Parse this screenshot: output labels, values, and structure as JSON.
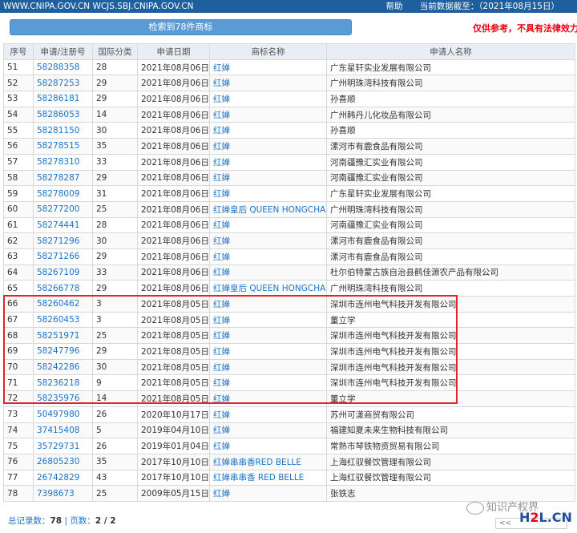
{
  "topbar": {
    "urls": "WWW.CNIPA.GOV.CN WCJS.SBJ.CNIPA.GOV.CN",
    "help": "帮助",
    "data_date": "当前数据截至：（2021年08月15日）"
  },
  "result_count": "检索到78件商标",
  "disclaimer": "仅供参考，不具有法律效力",
  "columns": [
    "序号",
    "申请/注册号",
    "国际分类",
    "申请日期",
    "商标名称",
    "申请人名称"
  ],
  "rows": [
    {
      "no": "51",
      "reg": "58288358",
      "cls": "28",
      "date": "2021年08月06日",
      "mark": "红婵",
      "applicant": "广东星轩实业发展有限公司"
    },
    {
      "no": "52",
      "reg": "58287253",
      "cls": "29",
      "date": "2021年08月06日",
      "mark": "红婵",
      "applicant": "广州明珠湾科技有限公司"
    },
    {
      "no": "53",
      "reg": "58286181",
      "cls": "29",
      "date": "2021年08月06日",
      "mark": "红婵",
      "applicant": "孙喜顺"
    },
    {
      "no": "54",
      "reg": "58286053",
      "cls": "14",
      "date": "2021年08月06日",
      "mark": "红婵",
      "applicant": "广州韩丹儿化妆品有限公司"
    },
    {
      "no": "55",
      "reg": "58281150",
      "cls": "30",
      "date": "2021年08月06日",
      "mark": "红婵",
      "applicant": "孙喜顺"
    },
    {
      "no": "56",
      "reg": "58278515",
      "cls": "35",
      "date": "2021年08月06日",
      "mark": "红婵",
      "applicant": "漯河市有鹿食品有限公司"
    },
    {
      "no": "57",
      "reg": "58278310",
      "cls": "33",
      "date": "2021年08月06日",
      "mark": "红婵",
      "applicant": "河南疆豫汇实业有限公司"
    },
    {
      "no": "58",
      "reg": "58278287",
      "cls": "29",
      "date": "2021年08月06日",
      "mark": "红婵",
      "applicant": "河南疆豫汇实业有限公司"
    },
    {
      "no": "59",
      "reg": "58278009",
      "cls": "31",
      "date": "2021年08月06日",
      "mark": "红婵",
      "applicant": "广东星轩实业发展有限公司"
    },
    {
      "no": "60",
      "reg": "58277200",
      "cls": "25",
      "date": "2021年08月06日",
      "mark": "红婵皇后 QUEEN HONGCHAN",
      "applicant": "广州明珠湾科技有限公司"
    },
    {
      "no": "61",
      "reg": "58274441",
      "cls": "28",
      "date": "2021年08月06日",
      "mark": "红婵",
      "applicant": "河南疆豫汇实业有限公司"
    },
    {
      "no": "62",
      "reg": "58271296",
      "cls": "30",
      "date": "2021年08月06日",
      "mark": "红婵",
      "applicant": "漯河市有鹿食品有限公司"
    },
    {
      "no": "63",
      "reg": "58271266",
      "cls": "29",
      "date": "2021年08月06日",
      "mark": "红婵",
      "applicant": "漯河市有鹿食品有限公司"
    },
    {
      "no": "64",
      "reg": "58267109",
      "cls": "33",
      "date": "2021年08月06日",
      "mark": "红婵",
      "applicant": "杜尔伯特蒙古族自治县鹤佳源农产品有限公司"
    },
    {
      "no": "65",
      "reg": "58266778",
      "cls": "29",
      "date": "2021年08月06日",
      "mark": "红婵皇后 QUEEN HONGCHAN",
      "applicant": "广州明珠湾科技有限公司"
    },
    {
      "no": "66",
      "reg": "58260462",
      "cls": "3",
      "date": "2021年08月05日",
      "mark": "红婵",
      "applicant": "深圳市连州电气科技开发有限公司"
    },
    {
      "no": "67",
      "reg": "58260453",
      "cls": "3",
      "date": "2021年08月05日",
      "mark": "红婵",
      "applicant": "董立学"
    },
    {
      "no": "68",
      "reg": "58251971",
      "cls": "25",
      "date": "2021年08月05日",
      "mark": "红婵",
      "applicant": "深圳市连州电气科技开发有限公司"
    },
    {
      "no": "69",
      "reg": "58247796",
      "cls": "29",
      "date": "2021年08月05日",
      "mark": "红婵",
      "applicant": "深圳市连州电气科技开发有限公司"
    },
    {
      "no": "70",
      "reg": "58242286",
      "cls": "30",
      "date": "2021年08月05日",
      "mark": "红婵",
      "applicant": "深圳市连州电气科技开发有限公司"
    },
    {
      "no": "71",
      "reg": "58236218",
      "cls": "9",
      "date": "2021年08月05日",
      "mark": "红婵",
      "applicant": "深圳市连州电气科技开发有限公司"
    },
    {
      "no": "72",
      "reg": "58235976",
      "cls": "14",
      "date": "2021年08月05日",
      "mark": "红婵",
      "applicant": "董立学"
    },
    {
      "no": "73",
      "reg": "50497980",
      "cls": "26",
      "date": "2020年10月17日",
      "mark": "红婵",
      "applicant": "苏州可漾商贸有限公司"
    },
    {
      "no": "74",
      "reg": "37415408",
      "cls": "5",
      "date": "2019年04月10日",
      "mark": "红婵",
      "applicant": "福建知夏未来生物科技有限公司"
    },
    {
      "no": "75",
      "reg": "35729731",
      "cls": "26",
      "date": "2019年01月04日",
      "mark": "红婵",
      "applicant": "常熟市琴铁物资贸易有限公司"
    },
    {
      "no": "76",
      "reg": "26805230",
      "cls": "35",
      "date": "2017年10月10日",
      "mark": "红婵串串香RED BELLE",
      "applicant": "上海红驭餐饮管理有限公司"
    },
    {
      "no": "77",
      "reg": "26742829",
      "cls": "43",
      "date": "2017年10月10日",
      "mark": "红婵串串香 RED BELLE",
      "applicant": "上海红驭餐饮管理有限公司"
    },
    {
      "no": "78",
      "reg": "7398673",
      "cls": "25",
      "date": "2009年05月15日",
      "mark": "红婵",
      "applicant": "张铁志"
    }
  ],
  "footer": {
    "total_label": "总记录数：",
    "total_value": "78",
    "sep": " | ",
    "page_label": "页数：",
    "page_value": "2 / 2"
  },
  "pager": {
    "first": "<<"
  },
  "watermark": {
    "text": "知识产权界"
  },
  "logo": {
    "part1": "H",
    "part2": "2",
    "part3": "L.CN"
  }
}
